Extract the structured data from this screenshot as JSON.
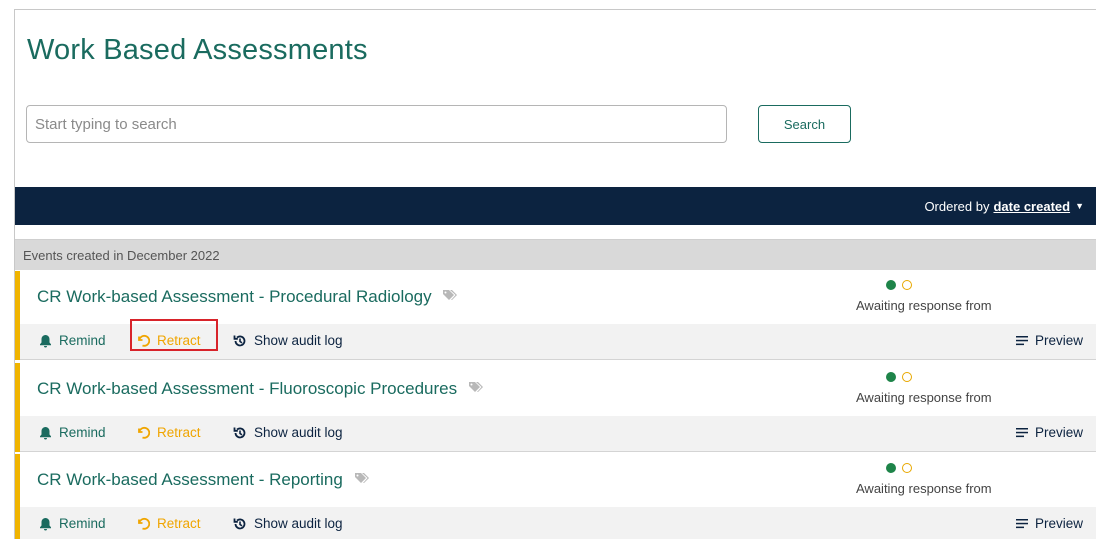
{
  "page": {
    "title": "Work Based Assessments"
  },
  "search": {
    "placeholder": "Start typing to search",
    "value": "",
    "button_label": "Search"
  },
  "ordering": {
    "prefix": "Ordered by",
    "field": "date created"
  },
  "group": {
    "header": "Events created in December 2022"
  },
  "events": [
    {
      "title": "CR Work-based Assessment - Procedural Radiology",
      "status": "Awaiting response from",
      "actions": {
        "remind": "Remind",
        "retract": "Retract",
        "audit": "Show audit log",
        "preview": "Preview"
      }
    },
    {
      "title": "CR Work-based Assessment - Fluoroscopic Procedures",
      "status": "Awaiting response from",
      "actions": {
        "remind": "Remind",
        "retract": "Retract",
        "audit": "Show audit log",
        "preview": "Preview"
      }
    },
    {
      "title": "CR Work-based Assessment - Reporting",
      "status": "Awaiting response from",
      "actions": {
        "remind": "Remind",
        "retract": "Retract",
        "audit": "Show audit log",
        "preview": "Preview"
      }
    }
  ],
  "icons": {
    "tag": "tag-icon",
    "bell": "bell-icon",
    "undo": "undo-icon",
    "history": "history-icon",
    "list": "list-icon"
  },
  "colors": {
    "brand_green": "#1a6b5f",
    "navy": "#0c2340",
    "accent_amber": "#f0b400",
    "highlight_red": "#d8232a"
  }
}
